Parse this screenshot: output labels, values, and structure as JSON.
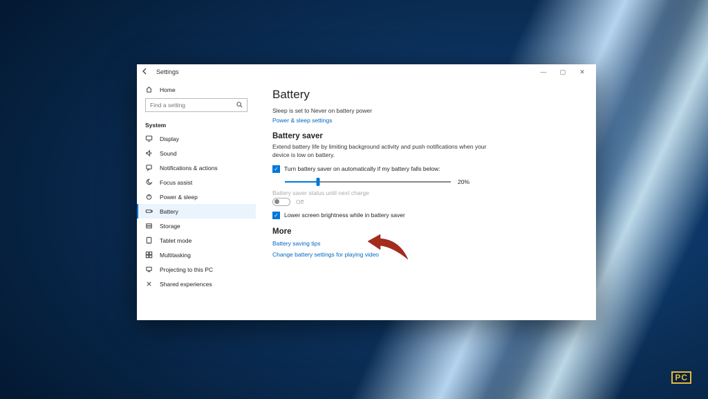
{
  "window": {
    "title": "Settings",
    "controls": {
      "minimize": "—",
      "maximize": "▢",
      "close": "✕"
    }
  },
  "sidebar": {
    "home_label": "Home",
    "search_placeholder": "Find a setting",
    "section_label": "System",
    "items": [
      {
        "label": "Display"
      },
      {
        "label": "Sound"
      },
      {
        "label": "Notifications & actions"
      },
      {
        "label": "Focus assist"
      },
      {
        "label": "Power & sleep"
      },
      {
        "label": "Battery"
      },
      {
        "label": "Storage"
      },
      {
        "label": "Tablet mode"
      },
      {
        "label": "Multitasking"
      },
      {
        "label": "Projecting to this PC"
      },
      {
        "label": "Shared experiences"
      }
    ]
  },
  "content": {
    "heading": "Battery",
    "sleep_status": "Sleep is set to Never on battery power",
    "power_link": "Power & sleep settings",
    "saver_heading": "Battery saver",
    "saver_desc": "Extend battery life by limiting background activity and push notifications when your device is low on battery.",
    "auto_on_label": "Turn battery saver on automatically if my battery falls below:",
    "threshold": "20%",
    "status_label": "Battery saver status until next charge",
    "toggle_state": "Off",
    "lower_brightness_label": "Lower screen brightness while in battery saver",
    "more_heading": "More",
    "tips_link": "Battery saving tips",
    "video_link": "Change battery settings for playing video"
  },
  "watermark": {
    "pc": "PC"
  }
}
